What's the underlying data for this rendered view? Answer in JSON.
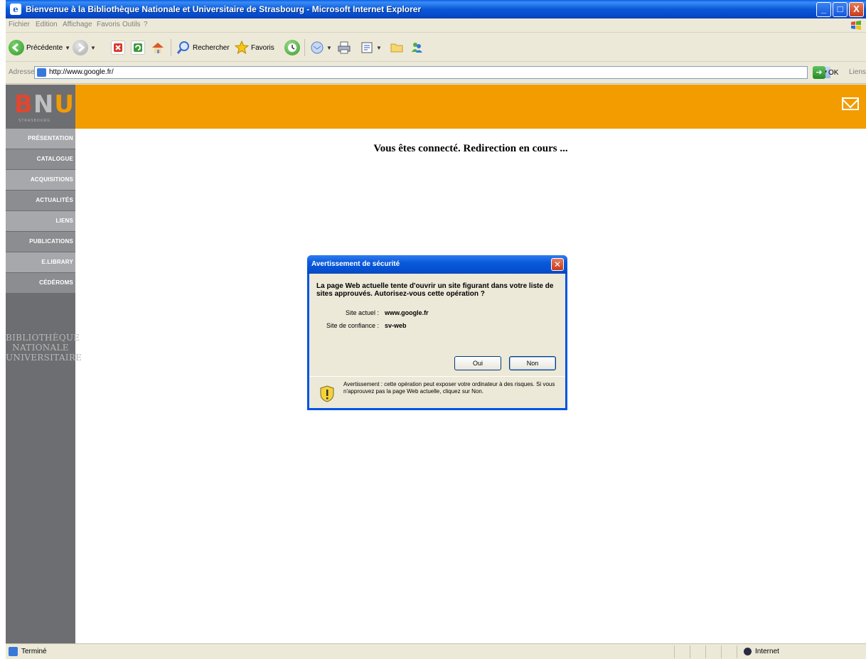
{
  "window": {
    "title": "Bienvenue à la Bibliothèque Nationale et Universitaire de Strasbourg - Microsoft Internet Explorer",
    "minimize_glyph": "_",
    "maximize_glyph": "□",
    "close_glyph": "X"
  },
  "menu": [
    "Fichier",
    "Edition",
    "Affichage",
    "Favoris",
    "Outils",
    "?"
  ],
  "toolbar": {
    "back_label": "Précédente",
    "search_label": "Rechercher",
    "favorites_label": "Favoris"
  },
  "address_bar": {
    "label": "Adresse",
    "url": "http://www.google.fr/",
    "go_label": "OK",
    "links_label": "Liens"
  },
  "site": {
    "logo": {
      "b": "B",
      "n": "N",
      "u": "U",
      "sub": "STRASBOURG"
    },
    "nav": [
      "PRÉSENTATION",
      "CATALOGUE",
      "ACQUISITIONS",
      "ACTUALITÉS",
      "LIENS",
      "PUBLICATIONS",
      "E.LIBRARY",
      "CÉDÉROMS"
    ],
    "side_text": [
      "BIBLIOTHÈQUE",
      "NATIONALE",
      "UNIVERSITAIRE"
    ],
    "colors": {
      "orange": "#f29c00",
      "gray": "#6d6e71"
    }
  },
  "content": {
    "message": "Vous êtes connecté. Redirection en cours ..."
  },
  "dialog": {
    "title": "Avertissement de sécurité",
    "close_glyph": "✕",
    "question": "La page Web actuelle tente d'ouvrir un site figurant dans votre liste de sites approuvés. Autorisez-vous cette opération ?",
    "current_site_label": "Site actuel :",
    "current_site_value": "www.google.fr",
    "trusted_site_label": "Site de confiance :",
    "trusted_site_value": "sv-web",
    "yes_label": "Oui",
    "no_label": "Non",
    "warning": "Avertissement : cette opération peut exposer votre ordinateur à des risques. Si vous n'approuvez pas la page Web actuelle, cliquez sur Non."
  },
  "status_bar": {
    "status": "Terminé",
    "zone": "Internet"
  }
}
